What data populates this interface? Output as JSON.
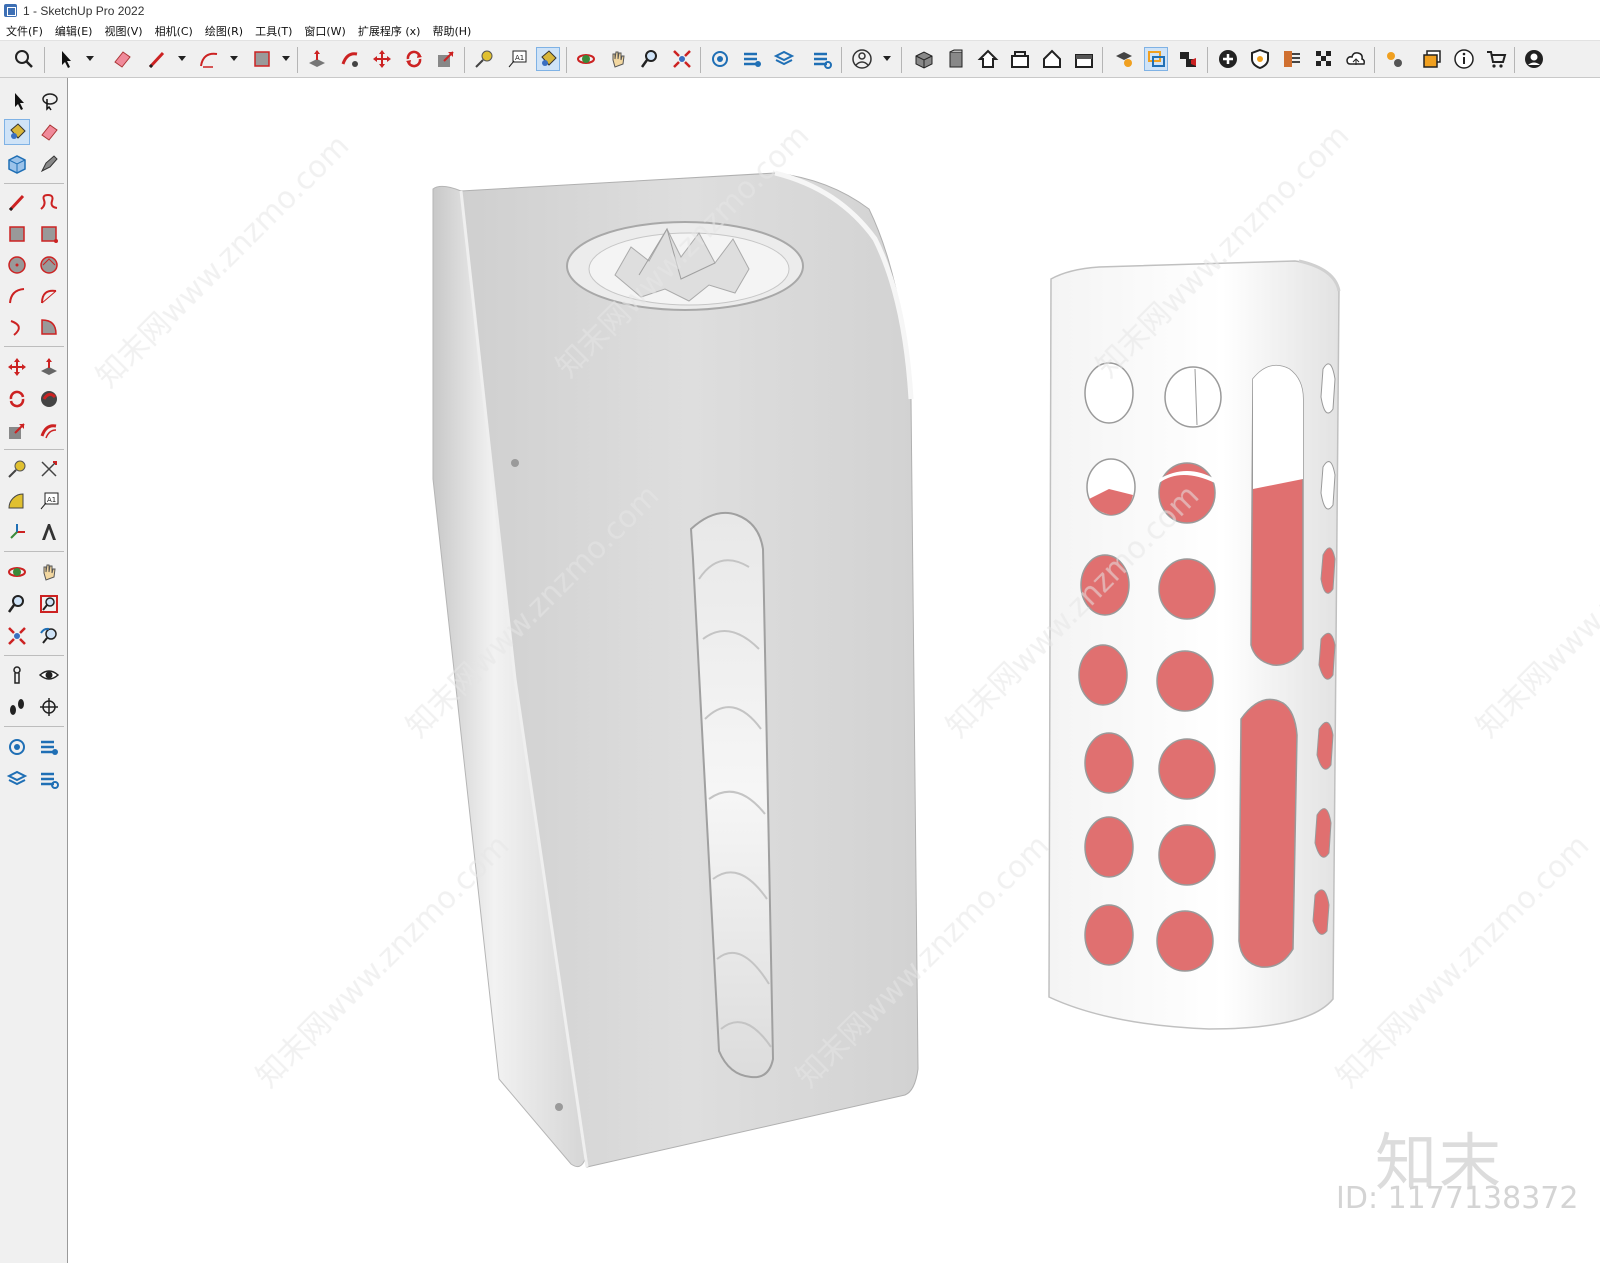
{
  "window": {
    "title": "1 - SketchUp Pro 2022"
  },
  "menu": [
    "文件(F)",
    "编辑(E)",
    "视图(V)",
    "相机(C)",
    "绘图(R)",
    "工具(T)",
    "窗口(W)",
    "扩展程序 (x)",
    "帮助(H)"
  ],
  "watermark": {
    "repeated_text": "知末网www.znzmo.com",
    "logo_text": "知末",
    "id_text": "ID: 1177138372"
  },
  "colors": {
    "toolbar_bg": "#f0f0f0",
    "active_tool": "#cfe3f7",
    "bag_fill": "#e07070",
    "model_white": "#ffffff"
  },
  "toolbar_icons": [
    "zoom-extents-icon",
    "select-icon",
    "eraser-icon",
    "pencil-icon",
    "arc-icon",
    "rectangle-icon",
    "push-pull-icon",
    "follow-me-icon",
    "move-icon",
    "rotate-icon",
    "scale-icon",
    "tape-measure-icon",
    "text-icon",
    "paint-bucket-icon",
    "orbit-icon",
    "pan-icon",
    "zoom-icon",
    "zoom-window-icon",
    "outliner-icon",
    "tags-icon",
    "layers-icon",
    "styles-icon",
    "account-icon",
    "iso-view-icon",
    "front-view-icon",
    "home-view-icon",
    "top-view-icon",
    "back-view-icon",
    "right-view-icon",
    "solid-tools-icon",
    "section-icon",
    "scene-camera-icon",
    "add-location-icon",
    "shield-icon",
    "materials-icon",
    "checker-icon",
    "cloud-icon",
    "extensions-icon",
    "warehouse-icon",
    "info-icon",
    "cart-icon",
    "profile-icon"
  ]
}
